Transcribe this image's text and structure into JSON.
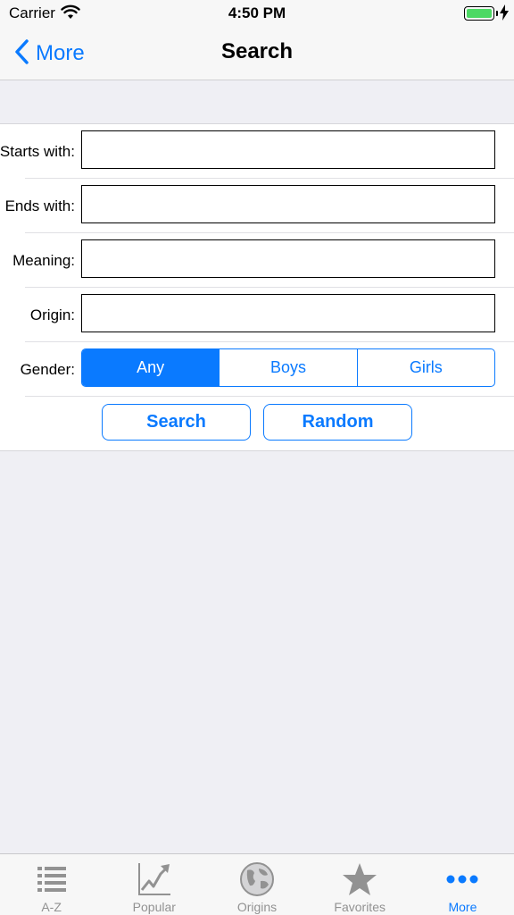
{
  "status_bar": {
    "carrier": "Carrier",
    "time": "4:50 PM",
    "battery_level": 1.0,
    "battery_color": "#4cd964"
  },
  "nav": {
    "back_label": "More",
    "title": "Search"
  },
  "form": {
    "starts_with_label": "Starts with:",
    "starts_with_value": "",
    "ends_with_label": "Ends with:",
    "ends_with_value": "",
    "meaning_label": "Meaning:",
    "meaning_value": "",
    "origin_label": "Origin:",
    "origin_value": "",
    "gender_label": "Gender:",
    "gender_options": [
      "Any",
      "Boys",
      "Girls"
    ],
    "gender_selected": "Any",
    "search_button": "Search",
    "random_button": "Random"
  },
  "tab_bar": {
    "items": [
      {
        "label": "A-Z",
        "icon": "list-icon"
      },
      {
        "label": "Popular",
        "icon": "trending-chart-icon"
      },
      {
        "label": "Origins",
        "icon": "globe-icon"
      },
      {
        "label": "Favorites",
        "icon": "star-icon"
      },
      {
        "label": "More",
        "icon": "more-dots-icon"
      }
    ],
    "active": "More"
  },
  "colors": {
    "accent": "#0a7aff",
    "inactive_tab": "#929292",
    "background": "#efeff4"
  }
}
